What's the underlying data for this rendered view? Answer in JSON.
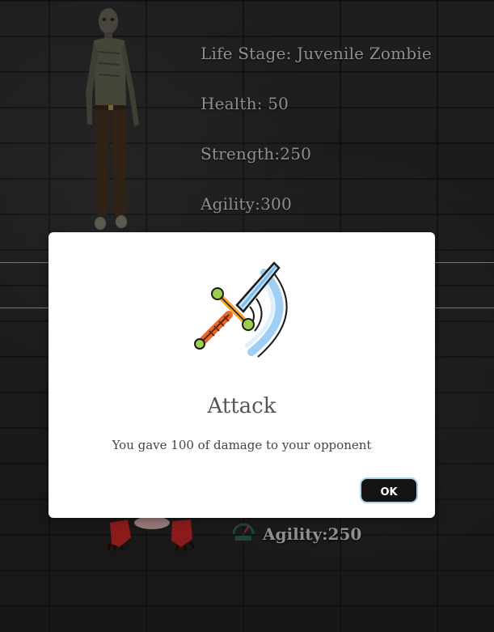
{
  "player": {
    "life_stage": "Life Stage: Juvenile Zombie",
    "health": "Health: 50",
    "strength": "Strength:250",
    "agility": "Agility:300"
  },
  "opponent": {
    "agility": "Agility:250",
    "speed_icon": "speed-gauge-icon"
  },
  "modal": {
    "icon": "sword-slash-icon",
    "title": "Attack",
    "message": "You gave 100 of damage to your opponent",
    "ok_label": "OK"
  },
  "colors": {
    "stat_text": "#dcdcdc",
    "modal_bg": "#ffffff",
    "ok_button_bg": "#141414",
    "ok_button_border": "#a9d3ea",
    "sword_blade": "#9fd0f3",
    "sword_handle": "#e8662a",
    "creature_red": "#d62a2a"
  }
}
